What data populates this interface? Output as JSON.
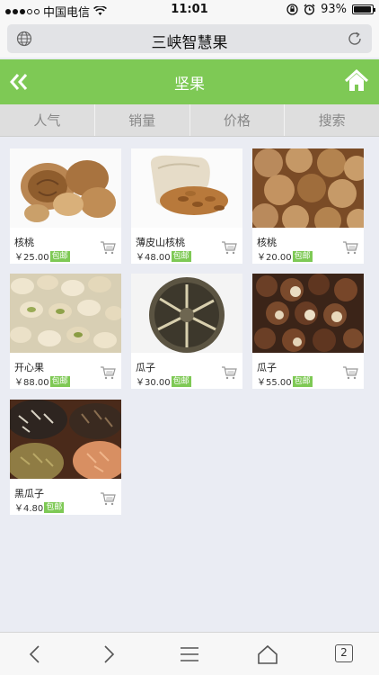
{
  "status_bar": {
    "carrier": "中国电信",
    "time": "11:01",
    "battery": "93%",
    "battery_level": 0.93
  },
  "browser": {
    "title": "三峡智慧果",
    "globe_icon": "globe-icon",
    "reload_icon": "reload-icon"
  },
  "header": {
    "title": "坚果",
    "back_icon": "double-chevron-left-icon",
    "home_icon": "home-icon",
    "color": "#7ec955"
  },
  "tabs": [
    {
      "label": "人气"
    },
    {
      "label": "销量"
    },
    {
      "label": "价格"
    },
    {
      "label": "搜索"
    }
  ],
  "products": [
    {
      "name": "核桃",
      "price": "￥25.00",
      "badge": "包邮"
    },
    {
      "name": "薄皮山核桃",
      "price": "￥48.00",
      "badge": "包邮"
    },
    {
      "name": "核桃",
      "price": "￥20.00",
      "badge": "包邮"
    },
    {
      "name": "开心果",
      "price": "￥88.00",
      "badge": "包邮"
    },
    {
      "name": "瓜子",
      "price": "￥30.00",
      "badge": "包邮"
    },
    {
      "name": "瓜子",
      "price": "￥55.00",
      "badge": "包邮"
    },
    {
      "name": "黑瓜子",
      "price": "￥4.80",
      "badge": "包邮"
    }
  ],
  "toolbar": {
    "tab_count": "2"
  }
}
